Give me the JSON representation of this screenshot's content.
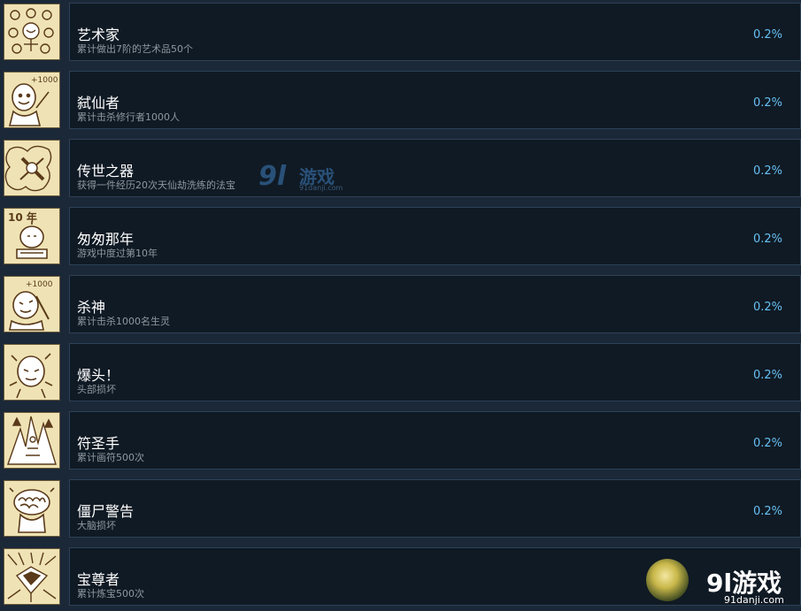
{
  "achievements": [
    {
      "title": "艺术家",
      "desc": "累计做出7阶的艺术品50个",
      "pct": "0.2%",
      "icon": "artist-icon"
    },
    {
      "title": "弑仙者",
      "desc": "累计击杀修行者1000人",
      "pct": "0.2%",
      "icon": "immortal-slayer-icon"
    },
    {
      "title": "传世之器",
      "desc": "获得一件经历20次天仙劫洗练的法宝",
      "pct": "0.2%",
      "icon": "legendary-artifact-icon"
    },
    {
      "title": "匆匆那年",
      "desc": "游戏中度过第10年",
      "pct": "0.2%",
      "icon": "ten-years-icon"
    },
    {
      "title": "杀神",
      "desc": "累计击杀1000名生灵",
      "pct": "0.2%",
      "icon": "god-of-slaughter-icon"
    },
    {
      "title": "爆头！",
      "desc": "头部损坏",
      "pct": "0.2%",
      "icon": "headshot-icon"
    },
    {
      "title": "符圣手",
      "desc": "累计画符500次",
      "pct": "0.2%",
      "icon": "talisman-master-icon"
    },
    {
      "title": "僵尸警告",
      "desc": "大脑损坏",
      "pct": "0.2%",
      "icon": "zombie-warning-icon"
    },
    {
      "title": "宝尊者",
      "desc": "累计炼宝500次",
      "pct": "",
      "icon": "treasure-lord-icon"
    }
  ],
  "icon_texts": {
    "immortal_slayer": "+1000",
    "ten_years": "10 年",
    "god_of_slaughter": "+1000"
  },
  "watermark_center": {
    "num": "9l",
    "text": "游戏",
    "url": "91danji.com"
  },
  "watermark_corner": {
    "text": "9l游戏",
    "url": "91danji.com"
  },
  "colors": {
    "background": "#1b2838",
    "panel": "#101a24",
    "border": "#2c4257",
    "title": "#ffffff",
    "desc": "#8f98a0",
    "percent": "#66c0f4",
    "icon_bg": "#efe3b5",
    "icon_ink": "#5a3a1a"
  }
}
